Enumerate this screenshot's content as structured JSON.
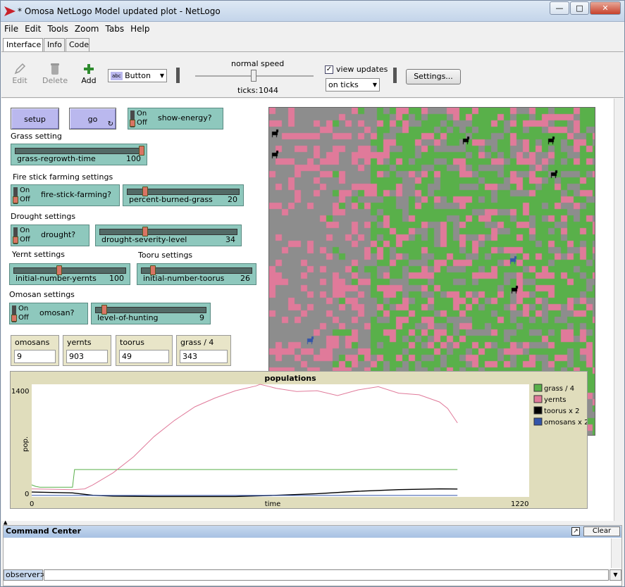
{
  "window": {
    "title": "* Omosa NetLogo Model updated plot - NetLogo"
  },
  "menu": [
    "File",
    "Edit",
    "Tools",
    "Zoom",
    "Tabs",
    "Help"
  ],
  "tabs": [
    "Interface",
    "Info",
    "Code"
  ],
  "toolbar": {
    "edit": "Edit",
    "delete": "Delete",
    "add": "Add",
    "widget_type": "Button",
    "widget_type_prefix": "abc",
    "speed_label": "normal speed",
    "ticks_label": "ticks:",
    "ticks": "1044",
    "view_updates_label": "view updates",
    "view_updates_checked": true,
    "update_mode": "on ticks",
    "settings": "Settings..."
  },
  "buttons": {
    "setup": "setup",
    "go": "go"
  },
  "switches": {
    "show_energy": {
      "label": "show-energy?",
      "state": "off"
    },
    "fire_stick": {
      "label": "fire-stick-farming?",
      "state": "off"
    },
    "drought": {
      "label": "drought?",
      "state": "off"
    },
    "omosan": {
      "label": "omosan?",
      "state": "off"
    },
    "on": "On",
    "off": "Off"
  },
  "notes": {
    "grass": "Grass setting",
    "fire": "Fire stick farming settings",
    "drought": "Drought settings",
    "yernt": "Yernt settings",
    "tooru": "Tooru settings",
    "omosan": "Omosan settings"
  },
  "sliders": {
    "grass_regrowth_time": {
      "label": "grass-regrowth-time",
      "value": "100",
      "fraction": 1.0
    },
    "percent_burned_grass": {
      "label": "percent-burned-grass",
      "value": "20",
      "fraction": 0.2
    },
    "drought_severity_level": {
      "label": "drought-severity-level",
      "value": "34",
      "fraction": 0.34
    },
    "initial_number_yernts": {
      "label": "initial-number-yernts",
      "value": "100",
      "fraction": 0.4
    },
    "initial_number_toorus": {
      "label": "initial-number-toorus",
      "value": "26",
      "fraction": 0.1
    },
    "level_of_hunting": {
      "label": "level-of-hunting",
      "value": "9",
      "fraction": 0.09
    }
  },
  "monitors": [
    {
      "label": "omosans",
      "value": "9"
    },
    {
      "label": "yernts",
      "value": "903"
    },
    {
      "label": "toorus",
      "value": "49"
    },
    {
      "label": "grass / 4",
      "value": "343"
    }
  ],
  "colors": {
    "grass": "#59b04a",
    "yernt": "#e07a9a",
    "tooru": "#000000",
    "omosan": "#3355aa",
    "bare": "#8d8d8d"
  },
  "chart_data": {
    "type": "line",
    "title": "populations",
    "xlabel": "time",
    "ylabel": "pop.",
    "xlim": [
      0,
      1220
    ],
    "ylim": [
      0,
      1400
    ],
    "x_tick_labels": [
      "0",
      "1220"
    ],
    "y_tick_labels": [
      "0",
      "1400"
    ],
    "legend_position": "right",
    "series": [
      {
        "name": "grass / 4",
        "color": "#59b04a",
        "x": [
          0,
          10,
          20,
          100,
          105,
          200,
          400,
          600,
          800,
          1044
        ],
        "y": [
          150,
          130,
          120,
          120,
          340,
          340,
          340,
          340,
          340,
          340
        ]
      },
      {
        "name": "yernts",
        "color": "#e07a9a",
        "x": [
          0,
          50,
          100,
          130,
          150,
          200,
          250,
          300,
          350,
          400,
          450,
          500,
          550,
          560,
          600,
          650,
          700,
          750,
          800,
          850,
          900,
          950,
          1000,
          1020,
          1044
        ],
        "y": [
          100,
          95,
          90,
          100,
          150,
          300,
          500,
          750,
          950,
          1120,
          1230,
          1320,
          1380,
          1400,
          1350,
          1310,
          1320,
          1260,
          1330,
          1370,
          1290,
          1270,
          1180,
          1100,
          920
        ]
      },
      {
        "name": "toorus x 2",
        "color": "#000000",
        "x": [
          0,
          100,
          150,
          200,
          300,
          400,
          500,
          600,
          700,
          800,
          900,
          1000,
          1044
        ],
        "y": [
          60,
          50,
          20,
          10,
          5,
          5,
          5,
          20,
          40,
          70,
          90,
          100,
          98
        ]
      },
      {
        "name": "omosans x 2",
        "color": "#3355aa",
        "x": [
          0,
          100,
          200,
          400,
          600,
          800,
          1000,
          1044
        ],
        "y": [
          20,
          18,
          18,
          18,
          18,
          18,
          18,
          18
        ]
      }
    ]
  },
  "command_center": {
    "title": "Command Center",
    "clear": "Clear",
    "prompt": "observer>"
  }
}
